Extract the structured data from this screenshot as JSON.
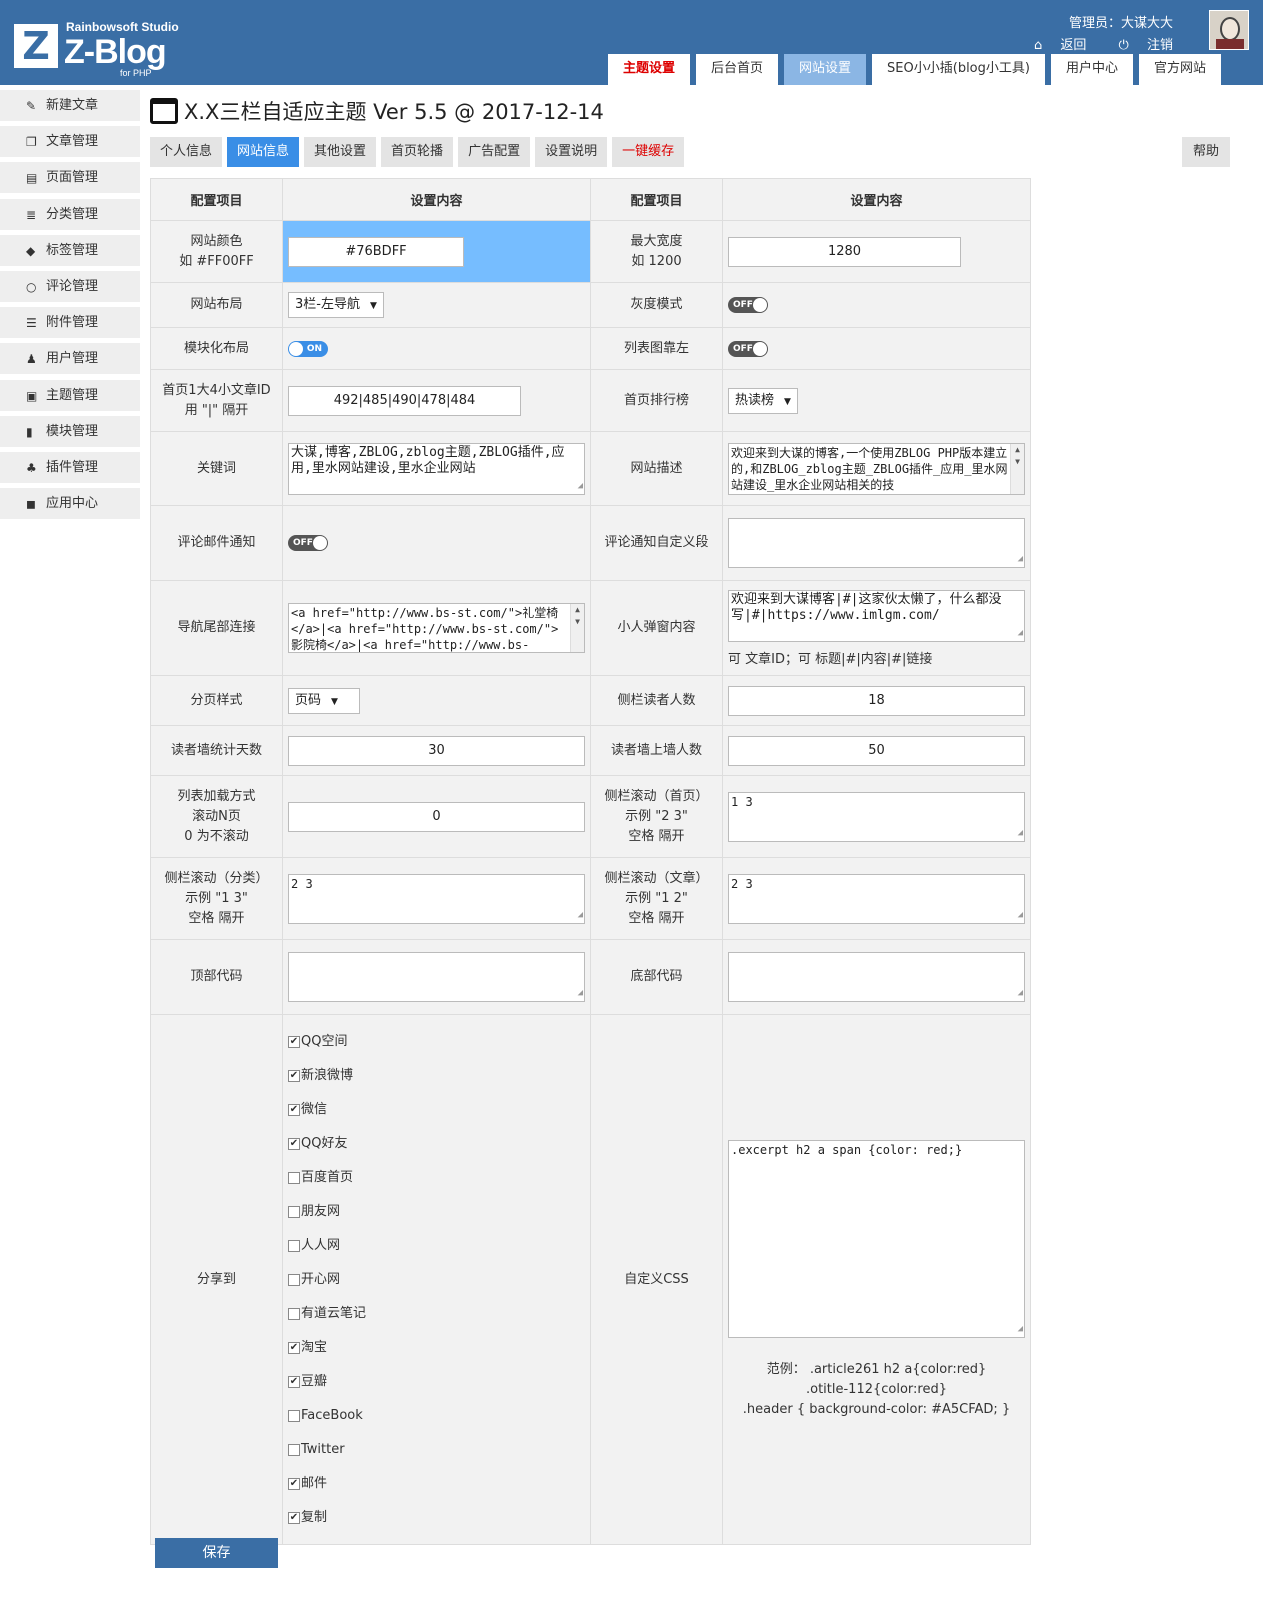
{
  "logo": {
    "studio": "Rainbowsoft Studio",
    "brand": "Z-Blog",
    "sub": "for PHP",
    "mark": "Z"
  },
  "user": {
    "label": "管理员：大谋大大",
    "back": "返回",
    "logout": "注销"
  },
  "top_tabs": [
    "主题设置",
    "后台首页",
    "网站设置",
    "SEO小小插(blog小工具)",
    "用户中心",
    "官方网站"
  ],
  "sidebar": {
    "items": [
      {
        "label": "新建文章",
        "icon": "edit-icon"
      },
      {
        "label": "文章管理",
        "icon": "documents-icon"
      },
      {
        "label": "页面管理",
        "icon": "page-icon"
      },
      {
        "label": "分类管理",
        "icon": "category-icon"
      },
      {
        "label": "标签管理",
        "icon": "tag-icon"
      },
      {
        "label": "评论管理",
        "icon": "comment-icon"
      },
      {
        "label": "附件管理",
        "icon": "attachment-icon"
      },
      {
        "label": "用户管理",
        "icon": "user-icon"
      },
      {
        "label": "主题管理",
        "icon": "theme-icon"
      },
      {
        "label": "模块管理",
        "icon": "module-icon"
      },
      {
        "label": "插件管理",
        "icon": "plugin-icon"
      },
      {
        "label": "应用中心",
        "icon": "app-center-icon"
      }
    ]
  },
  "page": {
    "title": "X.X三栏自适应主题 Ver 5.5 @ 2017-12-14"
  },
  "sub_tabs": [
    "个人信息",
    "网站信息",
    "其他设置",
    "首页轮播",
    "广告配置",
    "设置说明",
    "一键缓存"
  ],
  "help": "帮助",
  "table": {
    "headers": [
      "配置项目",
      "设置内容",
      "配置项目",
      "设置内容"
    ],
    "site_color": {
      "label1": "网站颜色",
      "label2": "如 #FF00FF",
      "value": "#76BDFF"
    },
    "max_width": {
      "label1": "最大宽度",
      "label2": "如 1200",
      "value": "1280"
    },
    "layout": {
      "label": "网站布局",
      "value": "3栏-左导航"
    },
    "gray_mode": {
      "label": "灰度模式",
      "state": "OFF"
    },
    "modular": {
      "label": "模块化布局",
      "state": "ON"
    },
    "list_img_left": {
      "label": "列表图靠左",
      "state": "OFF"
    },
    "home_ids": {
      "label1": "首页1大4小文章ID",
      "label2": "用 \"|\" 隔开",
      "value": "492|485|490|478|484"
    },
    "home_rank": {
      "label": "首页排行榜",
      "value": "热读榜"
    },
    "keywords": {
      "label": "关键词",
      "value": "大谋,博客,ZBLOG,zblog主题,ZBLOG插件,应用,里水网站建设,里水企业网站"
    },
    "description": {
      "label": "网站描述",
      "value": "欢迎来到大谋的博客,一个使用ZBLOG PHP版本建立的,和ZBLOG_zblog主题_ZBLOG插件_应用_里水网站建设_里水企业网站相关的技"
    },
    "comment_mail": {
      "label": "评论邮件通知",
      "state": "OFF"
    },
    "comment_custom": {
      "label": "评论通知自定义段",
      "value": ""
    },
    "nav_footer": {
      "label": "导航尾部连接",
      "value": "<a href=\"http://www.bs-st.com/\">礼堂椅</a>|<a href=\"http://www.bs-st.com/\">影院椅</a>|<a href=\"http://www.bs-"
    },
    "popup": {
      "label": "小人弹窗内容",
      "value": "欢迎来到大谋博客|#|这家伙太懒了，什么都没写|#|https://www.imlgm.com/",
      "hint": "可 文章ID；可 标题|#|内容|#|链接"
    },
    "pagination": {
      "label": "分页样式",
      "value": "页码"
    },
    "sidebar_readers": {
      "label": "侧栏读者人数",
      "value": "18"
    },
    "wall_days": {
      "label": "读者墙统计天数",
      "value": "30"
    },
    "wall_count": {
      "label": "读者墙上墙人数",
      "value": "50"
    },
    "list_load": {
      "label1": "列表加载方式",
      "label2": "滚动N页",
      "label3": "0 为不滚动",
      "value": "0"
    },
    "scroll_home": {
      "label1": "侧栏滚动（首页）",
      "label2": "示例 \"2 3\"",
      "label3": "空格 隔开",
      "value": "1 3"
    },
    "scroll_cat": {
      "label1": "侧栏滚动（分类）",
      "label2": "示例 \"1 3\"",
      "label3": "空格 隔开",
      "value": "2 3"
    },
    "scroll_post": {
      "label1": "侧栏滚动（文章）",
      "label2": "示例 \"1 2\"",
      "label3": "空格 隔开",
      "value": "2 3"
    },
    "top_code": {
      "label": "顶部代码",
      "value": ""
    },
    "bottom_code": {
      "label": "底部代码",
      "value": ""
    },
    "share": {
      "label": "分享到",
      "items": [
        {
          "label": "QQ空间",
          "checked": true
        },
        {
          "label": "新浪微博",
          "checked": true
        },
        {
          "label": "微信",
          "checked": true
        },
        {
          "label": "QQ好友",
          "checked": true
        },
        {
          "label": "百度首页",
          "checked": false
        },
        {
          "label": "朋友网",
          "checked": false
        },
        {
          "label": "人人网",
          "checked": false
        },
        {
          "label": "开心网",
          "checked": false
        },
        {
          "label": "有道云笔记",
          "checked": false
        },
        {
          "label": "淘宝",
          "checked": true
        },
        {
          "label": "豆瓣",
          "checked": true
        },
        {
          "label": "FaceBook",
          "checked": false
        },
        {
          "label": "Twitter",
          "checked": false
        },
        {
          "label": "邮件",
          "checked": true
        },
        {
          "label": "复制",
          "checked": true
        }
      ]
    },
    "custom_css": {
      "label": "自定义CSS",
      "value": ".excerpt h2 a span {color: red;}",
      "example1": "范例：  .article261 h2 a{color:red}",
      "example2": ".otitle-112{color:red}",
      "example3": ".header { background-color: #A5CFAD; }"
    }
  },
  "save": "保存",
  "colors": {
    "header": "#3a6ea5",
    "accent": "#3a8ee6",
    "site_color": "#76BDFF"
  }
}
